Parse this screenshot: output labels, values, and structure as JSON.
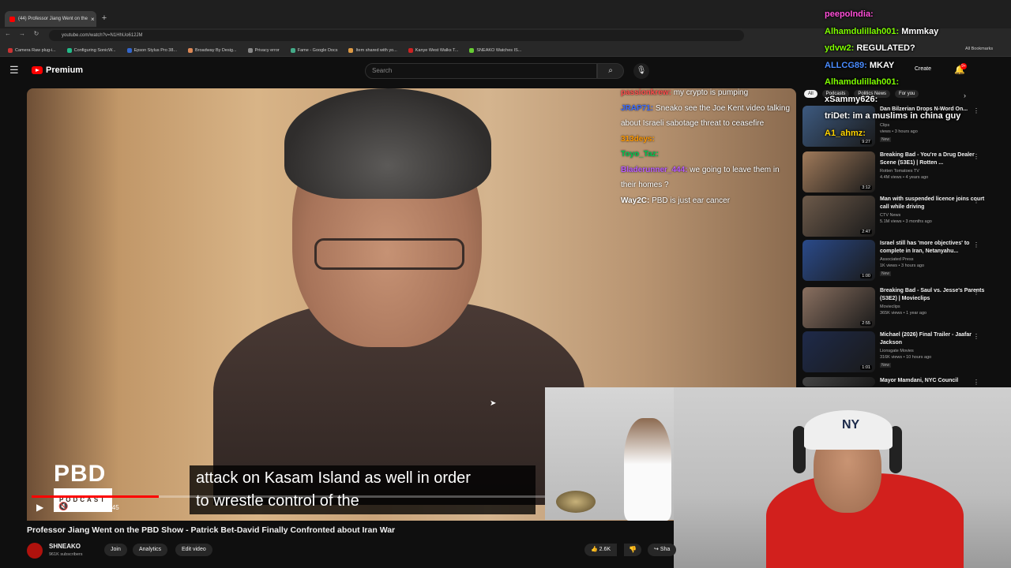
{
  "browser": {
    "tab_title": "(44) Professor Jiang Went on the",
    "url": "youtube.com/watch?v=N1HhUo612JM",
    "bookmarks": [
      "Camera Raw plug-i...",
      "Configuring SonicW...",
      "Epson Stylus Pro 38...",
      "Broadway By Desig...",
      "Privacy error",
      "Fame - Google Docs",
      "Item shared with yo...",
      "Kanye West Walks T...",
      "SNEAKO Watches IS..."
    ],
    "all_bookmarks": "All Bookmarks"
  },
  "youtube": {
    "brand": "Premium",
    "search_placeholder": "Search",
    "create_label": "Create",
    "notif_count": "9+"
  },
  "video": {
    "title": "Professor Jiang Went on the PBD Show - Patrick Bet-David Finally Confronted about Iran War",
    "time": "13:51 / 55:45",
    "progress": 0.248,
    "caption_line1": "attack on Kasam Island as well in order",
    "caption_line2": "to wrestle control of the",
    "logo_main": "PBD",
    "logo_sub": "PODCAST",
    "chat": [
      {
        "user": "passionkrew:",
        "text": "my crypto is pumping",
        "color": "#ff4d4d"
      },
      {
        "user": "JRAP71:",
        "text": "Sneako see the Joe Kent video talking about Israeli sabotage threat to ceasefire",
        "color": "#3a6bff"
      },
      {
        "user": "313deys:",
        "text": "",
        "color": "#ff9900"
      },
      {
        "user": "Toyo_Taz:",
        "text": "",
        "color": "#00c853"
      },
      {
        "user": "Bladerunner_444:",
        "text": "we going to leave them in their homes ?",
        "color": "#b95cff"
      },
      {
        "user": "Way2C:",
        "text": "PBD is just ear cancer",
        "color": "#ffffff"
      }
    ]
  },
  "channel": {
    "name": "SHNEAKO",
    "subs": "961K subscribers",
    "join": "Join",
    "analytics": "Analytics",
    "edit": "Edit video",
    "likes": "2.6K",
    "share": "Sha"
  },
  "sidebar": {
    "chips": [
      "All",
      "Podcasts",
      "Politics News",
      "For you"
    ],
    "items": [
      {
        "title": "Dan Bilzerian Drops N-Word On...",
        "channel": "Clips",
        "meta": "views • 3 hours ago",
        "dur": "9:27",
        "new": "New",
        "color": "#3d5a80"
      },
      {
        "title": "Breaking Bad - You're a Drug Dealer Scene (S3E1) | Rotten ...",
        "channel": "Rotten Tomatoes TV",
        "meta": "4.4M views • 4 years ago",
        "dur": "3:12",
        "new": "",
        "color": "#a07a5a"
      },
      {
        "title": "Man with suspended licence joins court call while driving",
        "channel": "CTV News",
        "meta": "5.1M views • 3 months ago",
        "dur": "2:47",
        "new": "",
        "color": "#6d5a4a"
      },
      {
        "title": "Israel still has 'more objectives' to complete in Iran, Netanyahu...",
        "channel": "Associated Press",
        "meta": "1K views • 3 hours ago",
        "dur": "1:00",
        "new": "New",
        "color": "#2a4a8a"
      },
      {
        "title": "Breaking Bad - Saul vs. Jesse's Parents (S3E2) | Movieclips",
        "channel": "Movieclips",
        "meta": "365K views • 1 year ago",
        "dur": "2:55",
        "new": "",
        "color": "#8a7060"
      },
      {
        "title": "Michael (2026) Final Trailer - Jaafar Jackson",
        "channel": "Lionsgate Movies",
        "meta": "316K views • 10 hours ago",
        "dur": "1:01",
        "new": "New",
        "color": "#1e2a4a"
      },
      {
        "title": "Mayor Mamdani, NYC Council",
        "channel": "",
        "meta": "",
        "dur": "",
        "new": "",
        "color": "#444444"
      }
    ]
  },
  "stream_chat": [
    {
      "user": "peepoIndia:",
      "text": "",
      "color": "#ff4fd8"
    },
    {
      "user": "Alhamdulillah001:",
      "text": "Mmmkay",
      "color": "#7fff00"
    },
    {
      "user": "ydvw2:",
      "text": "REGULATED?",
      "color": "#7fff00"
    },
    {
      "user": "ALLCG89:",
      "text": "MKAY",
      "color": "#4a8cff"
    },
    {
      "user": "Alhamdulillah001:",
      "text": "",
      "color": "#7fff00"
    },
    {
      "user": "xSammy626:",
      "text": "",
      "color": "#ffffff"
    },
    {
      "user": "triDet:",
      "text": "im a muslims in china guy",
      "color": "#ffffff"
    },
    {
      "user": "A1_ahmz:",
      "text": "",
      "color": "#ffd400"
    }
  ]
}
